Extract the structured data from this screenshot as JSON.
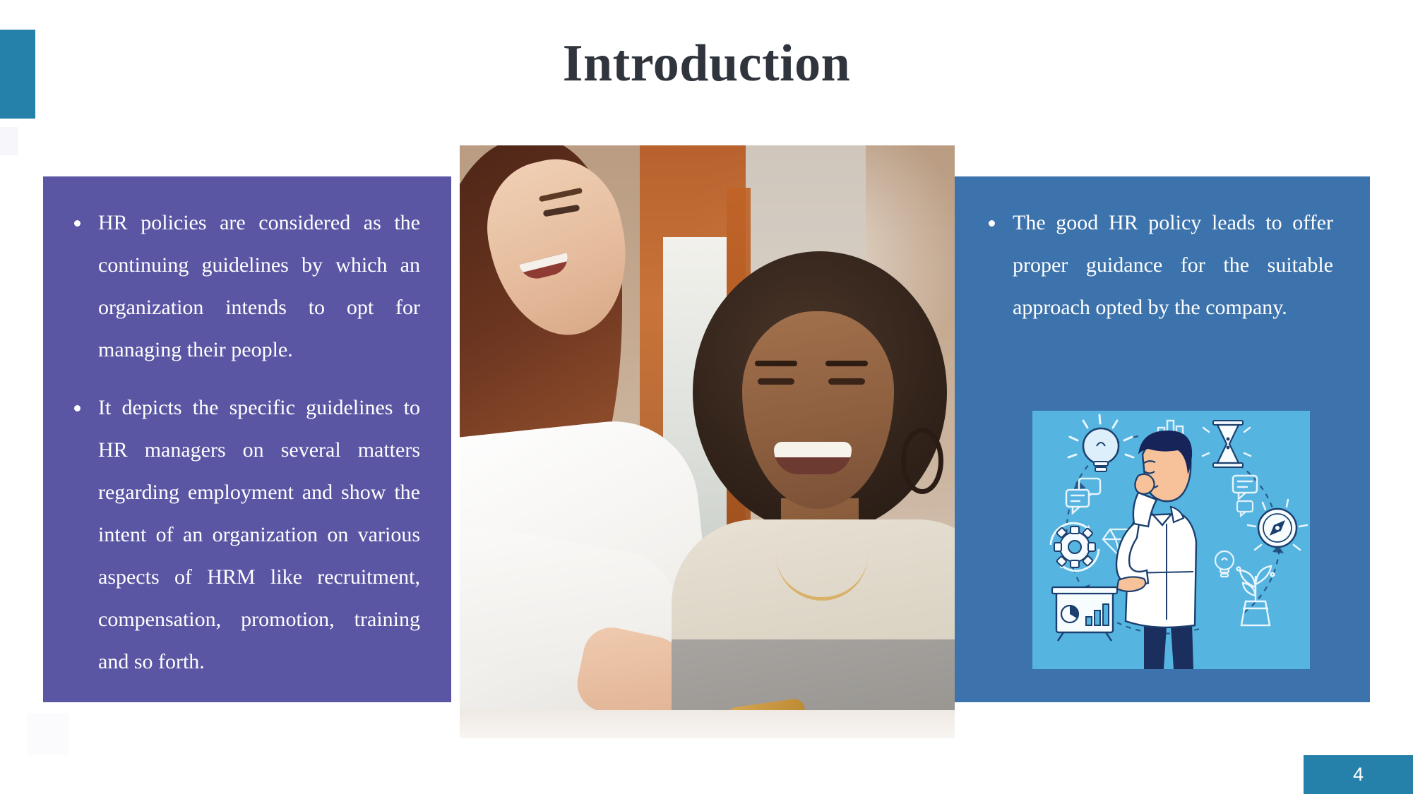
{
  "slide": {
    "title": "Introduction",
    "page_number": "4",
    "colors": {
      "title_text": "#30343d",
      "left_panel": "#5a56a4",
      "right_panel": "#3d73ac",
      "accent_teal": "#2580aa",
      "illustration_bg": "#55b4e0",
      "bullet_text": "#ffffff"
    }
  },
  "left_panel": {
    "bullets": [
      "HR policies are considered as the continuing guidelines by which an organization intends to opt for managing their people.",
      "It depicts the specific guidelines to HR managers on several matters regarding employment and show the intent of an organization on various aspects of HRM like recruitment, compensation, promotion, training and so forth."
    ]
  },
  "right_panel": {
    "bullets": [
      "The good HR policy leads to offer proper guidance for the suitable approach opted by the company."
    ],
    "illustration": {
      "alt": "Businessman thinking surrounded by idea icons",
      "icons": [
        "lightbulb-icon",
        "bar-chart-icon",
        "hourglass-icon",
        "speech-bubble-icon",
        "gear-cycle-icon",
        "diamond-icon",
        "compass-icon",
        "small-bulb-icon",
        "plant-icon",
        "presentation-chart-icon"
      ]
    }
  },
  "center_photo": {
    "alt": "Two smiling women collaborating at a desk in an office"
  }
}
